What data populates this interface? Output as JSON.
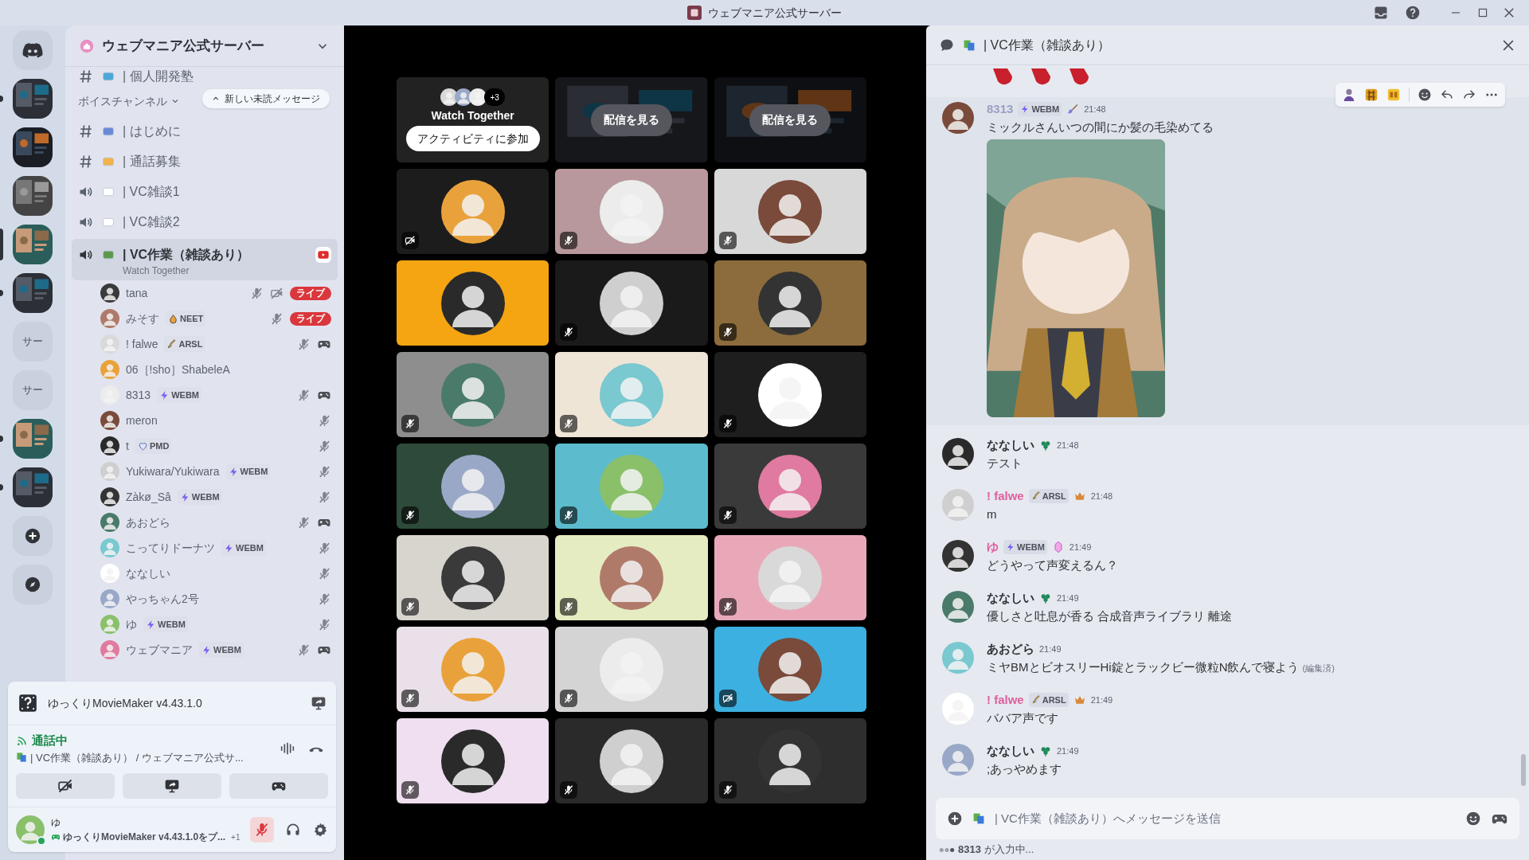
{
  "window": {
    "title": "ウェブマニア公式サーバー"
  },
  "servers": [
    {
      "kind": "home",
      "unread": false,
      "selected": false
    },
    {
      "kind": "picture",
      "unread": true,
      "selected": false
    },
    {
      "kind": "picture",
      "unread": false,
      "selected": false
    },
    {
      "kind": "picture",
      "unread": false,
      "selected": false
    },
    {
      "kind": "picture",
      "unread": false,
      "selected": true
    },
    {
      "kind": "picture",
      "unread": true,
      "selected": false
    },
    {
      "kind": "text",
      "label": "サー",
      "unread": false,
      "selected": false
    },
    {
      "kind": "text",
      "label": "サー",
      "unread": false,
      "selected": false
    },
    {
      "kind": "picture",
      "unread": true,
      "selected": false
    },
    {
      "kind": "picture",
      "unread": true,
      "selected": false
    },
    {
      "kind": "add",
      "unread": false,
      "selected": false
    },
    {
      "kind": "explore",
      "unread": false,
      "selected": false
    }
  ],
  "sidebar": {
    "server_name": "ウェブマニア公式サーバー",
    "new_messages_pill": "新しい未読メッセージ",
    "category": "ボイスチャンネル",
    "channels": [
      {
        "kind": "text",
        "name": "| 個人開発塾",
        "selected": false
      },
      {
        "kind": "text",
        "name": "| はじめに",
        "selected": false
      },
      {
        "kind": "text",
        "name": "| 通話募集",
        "selected": false
      },
      {
        "kind": "voice",
        "name": "| VC雑談1",
        "selected": false
      },
      {
        "kind": "voice",
        "name": "| VC雑談2",
        "selected": false
      },
      {
        "kind": "voice",
        "name": "| VC作業（雑談あり）",
        "selected": true,
        "activity": "Watch Together"
      }
    ],
    "members": [
      {
        "name": "tana",
        "muted": true,
        "video_off": true,
        "live": "ライブ",
        "playing": false
      },
      {
        "name": "みそす",
        "tag": {
          "kind": "drop",
          "label": "NEET"
        },
        "muted": true,
        "video_off": false,
        "live": "ライブ",
        "playing": false
      },
      {
        "name": "! falwe",
        "tag": {
          "kind": "sword",
          "label": "ARSL"
        },
        "muted": true,
        "video_off": false,
        "playing": true
      },
      {
        "name": "06［!sho］ShabeleA",
        "muted": false,
        "video_off": false,
        "playing": false
      },
      {
        "name": "8313",
        "tag": {
          "kind": "bolt",
          "label": "WEBM"
        },
        "muted": true,
        "video_off": false,
        "playing": true
      },
      {
        "name": "meron",
        "muted": true,
        "video_off": false,
        "playing": false
      },
      {
        "name": "t",
        "tag": {
          "kind": "heart",
          "label": "PMD"
        },
        "muted": true,
        "video_off": false,
        "playing": false
      },
      {
        "name": "Yukiwara/Yukiwara",
        "tag": {
          "kind": "bolt",
          "label": "WEBM"
        },
        "muted": true,
        "video_off": false,
        "playing": false
      },
      {
        "name": "Zàkø_Sâ",
        "tag": {
          "kind": "bolt",
          "label": "WEBM"
        },
        "muted": true,
        "video_off": false,
        "playing": false
      },
      {
        "name": "あおどら",
        "muted": true,
        "video_off": false,
        "playing": true
      },
      {
        "name": "こってりドーナツ",
        "tag": {
          "kind": "bolt",
          "label": "WEBM"
        },
        "muted": true,
        "video_off": false,
        "playing": false
      },
      {
        "name": "ななしい",
        "muted": true,
        "video_off": false,
        "playing": false
      },
      {
        "name": "やっちゃん2号",
        "muted": true,
        "video_off": false,
        "playing": false
      },
      {
        "name": "ゆ",
        "tag": {
          "kind": "bolt",
          "label": "WEBM"
        },
        "muted": true,
        "video_off": false,
        "playing": false
      },
      {
        "name": "ウェブマニア",
        "tag": {
          "kind": "bolt",
          "label": "WEBM"
        },
        "muted": true,
        "video_off": false,
        "playing": true
      }
    ]
  },
  "panel": {
    "activity": "ゆっくりMovieMaker v4.43.1.0",
    "voice_status": "通話中",
    "voice_channel": "| VC作業（雑談あり） / ウェブマニア公式サ...",
    "user": {
      "name": "ゆ",
      "status": "ゆっくりMovieMaker v4.43.1.0をプ...",
      "extra": "+1",
      "mic_muted": true
    }
  },
  "stage": {
    "watch_together": {
      "more": "+3",
      "title": "Watch Together",
      "button": "アクティビティに参加"
    },
    "streams": [
      {
        "button": "配信を見る"
      },
      {
        "button": "配信を見る"
      }
    ],
    "tiles": [
      {
        "color": "#1c1c1c",
        "muted": false,
        "video_off": true
      },
      {
        "color": "#b8989c",
        "muted": true,
        "video_off": false
      },
      {
        "color": "#d8d8d8",
        "muted": true,
        "video_off": false
      },
      {
        "color": "#f5a512",
        "muted": false,
        "video_off": false
      },
      {
        "color": "#1a1a1a",
        "muted": true,
        "video_off": false
      },
      {
        "color": "#8c6c3c",
        "muted": true,
        "video_off": false
      },
      {
        "color": "#8e8e8e",
        "muted": true,
        "video_off": false
      },
      {
        "color": "#efe5d6",
        "muted": true,
        "video_off": false
      },
      {
        "color": "#1e1e1e",
        "muted": true,
        "video_off": false
      },
      {
        "color": "#2e4a3a",
        "muted": true,
        "video_off": false
      },
      {
        "color": "#5cbccd",
        "muted": true,
        "video_off": false
      },
      {
        "color": "#3a3a3a",
        "muted": true,
        "video_off": false
      },
      {
        "color": "#d8d5cf",
        "muted": true,
        "video_off": false
      },
      {
        "color": "#e6ecc2",
        "muted": true,
        "video_off": false
      },
      {
        "color": "#e9a8b8",
        "muted": true,
        "video_off": false
      },
      {
        "color": "#e9e0ea",
        "muted": true,
        "video_off": false
      },
      {
        "color": "#d4d4d4",
        "muted": true,
        "video_off": false
      },
      {
        "color": "#3cb0e0",
        "muted": false,
        "video_off": true
      },
      {
        "color": "#efdff0",
        "muted": true,
        "video_off": false
      },
      {
        "color": "#2a2a2a",
        "muted": true,
        "video_off": false
      },
      {
        "color": "#2e2e2e",
        "muted": true,
        "video_off": false
      }
    ]
  },
  "chat": {
    "title": "| VC作業（雑談あり）",
    "messages": [
      {
        "author": "8313",
        "color": "#9aa0c4",
        "tag": "WEBM",
        "badge": {
          "kind": "brush"
        },
        "time": "21:48",
        "text": "ミックルさんいつの間にか髪の毛染めてる",
        "image": {
          "kind": "picture"
        },
        "hovered": true
      },
      {
        "author": "ななしい",
        "color": "#2e3338",
        "badge": {
          "kind": "clover"
        },
        "time": "21:48",
        "text": "テスト",
        "hovered": false
      },
      {
        "author": "! falwe",
        "color": "#e0609e",
        "tag": "ARSL",
        "badge": {
          "kind": "crown"
        },
        "time": "21:48",
        "text": "m",
        "hovered": false
      },
      {
        "author": "ゆ",
        "color": "#e0609e",
        "tag": "WEBM",
        "badge": {
          "kind": "gem"
        },
        "time": "21:49",
        "text": "どうやって声変えるん？",
        "hovered": false
      },
      {
        "author": "ななしい",
        "color": "#2e3338",
        "badge": {
          "kind": "clover"
        },
        "time": "21:49",
        "text": "優しさと吐息が香る 合成音声ライブラリ 離途",
        "hovered": false
      },
      {
        "author": "あおどら",
        "color": "#2e3338",
        "time": "21:49",
        "text": "ミヤBMとビオスリーHi錠とラックビー微粒N飲んで寝よう",
        "edited": "(編集済)",
        "hovered": false
      },
      {
        "author": "! falwe",
        "color": "#e0609e",
        "tag": "ARSL",
        "badge": {
          "kind": "crown"
        },
        "time": "21:49",
        "text": "ババア声です",
        "hovered": false
      },
      {
        "author": "ななしい",
        "color": "#2e3338",
        "badge": {
          "kind": "clover"
        },
        "time": "21:49",
        "text": ";あっやめます",
        "hovered": false
      }
    ],
    "input": {
      "placeholder": "| VC作業（雑談あり）へメッセージを送信"
    },
    "typing": {
      "user": "8313",
      "text": "が入力中..."
    }
  }
}
